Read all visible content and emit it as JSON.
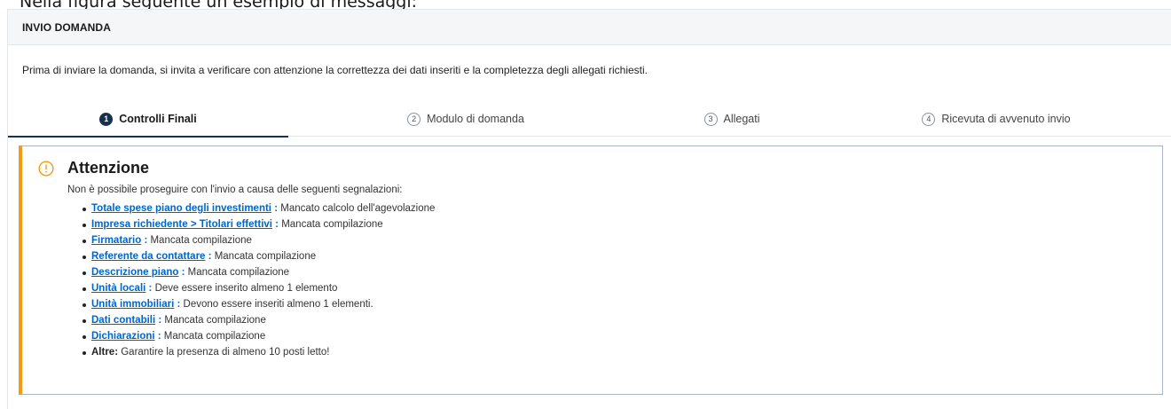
{
  "doc_caption": "Nella figura seguente un esempio di messaggi:",
  "section": {
    "title": "INVIO DOMANDA",
    "intro": "Prima di inviare la domanda, si invita a verificare con attenzione la correttezza dei dati inseriti e la completezza degli allegati richiesti."
  },
  "steps": [
    {
      "num": "1",
      "label": "Controlli Finali",
      "active": true
    },
    {
      "num": "2",
      "label": "Modulo di domanda",
      "active": false
    },
    {
      "num": "3",
      "label": "Allegati",
      "active": false
    },
    {
      "num": "4",
      "label": "Ricevuta di avvenuto invio",
      "active": false
    }
  ],
  "alert": {
    "icon": "warning-circle-icon",
    "accent_color": "#f39c12",
    "title": "Attenzione",
    "description": "Non è possibile proseguire con l'invio a causa delle seguenti segnalazioni:",
    "items": [
      {
        "label": "Totale spese piano degli investimenti",
        "sep": " :",
        "message": " Mancato calcolo dell'agevolazione"
      },
      {
        "label": "Impresa richiedente > Titolari effettivi",
        "sep": " :",
        "message": " Mancata compilazione"
      },
      {
        "label": "Firmatario",
        "sep": " :",
        "message": " Mancata compilazione"
      },
      {
        "label": "Referente da contattare",
        "sep": " :",
        "message": " Mancata compilazione"
      },
      {
        "label": "Descrizione piano",
        "sep": " :",
        "message": " Mancata compilazione"
      },
      {
        "label": "Unità locali",
        "sep": " :",
        "message": " Deve essere inserito almeno 1 elemento"
      },
      {
        "label": "Unità immobiliari",
        "sep": " :",
        "message": " Devono essere inseriti almeno 1 elementi."
      },
      {
        "label": "Dati contabili",
        "sep": " :",
        "message": " Mancata compilazione"
      },
      {
        "label": "Dichiarazioni",
        "sep": " :",
        "message": " Mancata compilazione"
      }
    ],
    "other": {
      "label": "Altre:",
      "message": " Garantire la presenza di almeno 10 posti letto!"
    }
  }
}
